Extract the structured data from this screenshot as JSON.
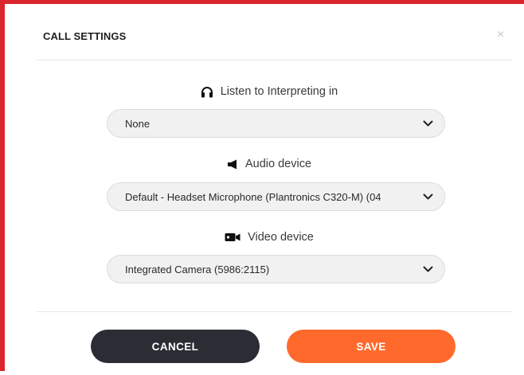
{
  "dialog": {
    "title": "CALL SETTINGS",
    "close_glyph": "×"
  },
  "fields": {
    "interpreting": {
      "icon": "headphones-icon",
      "label": "Listen to Interpreting in",
      "value": "None"
    },
    "audio": {
      "icon": "speaker-icon",
      "label": "Audio device",
      "value": "Default - Headset Microphone (Plantronics C320-M) (04"
    },
    "video": {
      "icon": "video-camera-icon",
      "label": "Video device",
      "value": "Integrated Camera (5986:2115)"
    }
  },
  "actions": {
    "cancel_label": "CANCEL",
    "save_label": "SAVE"
  },
  "colors": {
    "frame_border": "#d9252b",
    "cancel_bg": "#2a2d33",
    "save_bg": "#ff6a2c"
  }
}
